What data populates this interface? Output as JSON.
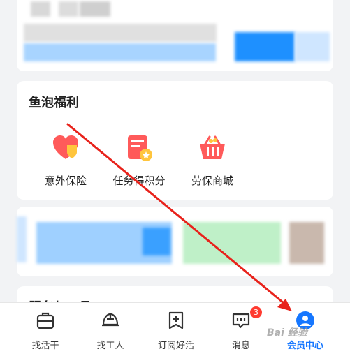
{
  "fuli": {
    "title": "鱼泡福利",
    "items": [
      {
        "label": "意外保险",
        "icon": "heart-shield-icon"
      },
      {
        "label": "任务得积分",
        "icon": "task-card-icon"
      },
      {
        "label": "劳保商城",
        "icon": "shopping-basket-icon"
      }
    ]
  },
  "next_section_title": "服务与工具",
  "tabbar": {
    "items": [
      {
        "label": "找活干",
        "icon": "briefcase-icon"
      },
      {
        "label": "找工人",
        "icon": "hard-hat-icon"
      },
      {
        "label": "订阅好活",
        "icon": "bookmark-plus-icon"
      },
      {
        "label": "消息",
        "icon": "message-icon",
        "badge": "3"
      },
      {
        "label": "会员中心",
        "icon": "member-icon",
        "active": true
      }
    ]
  },
  "watermark": "Bai 经验",
  "colors": {
    "accent": "#1677ff",
    "badge": "#ff3b30",
    "annotation_arrow": "#e8221b"
  }
}
